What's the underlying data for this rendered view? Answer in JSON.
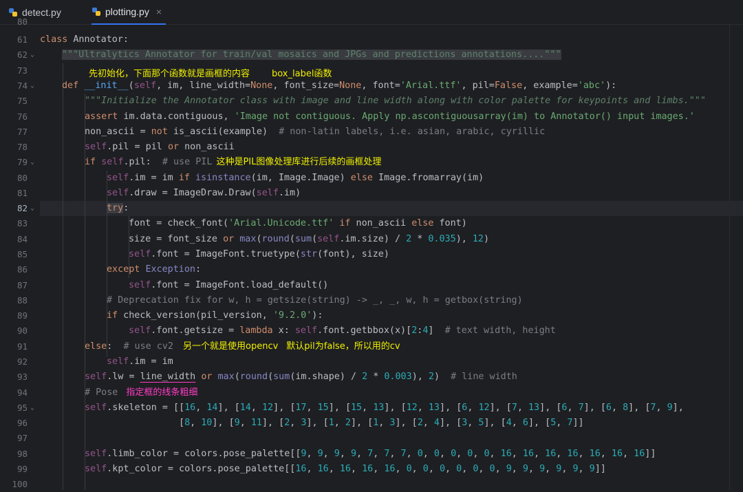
{
  "tabs": [
    {
      "label": "detect.py",
      "icon": "python-icon"
    },
    {
      "label": "plotting.py",
      "icon": "python-icon",
      "active": true
    }
  ],
  "close_glyph": "×",
  "line_numbers": [
    "80",
    "61",
    "62",
    "73",
    "74",
    "75",
    "76",
    "77",
    "78",
    "79",
    "80",
    "81",
    "82",
    "83",
    "84",
    "85",
    "86",
    "87",
    "88",
    "89",
    "90",
    "91",
    "92",
    "93",
    "94",
    "95",
    "96",
    "97",
    "98",
    "99",
    "100"
  ],
  "annotations": {
    "line73_a": "先初始化，下面那个函数就是画框的内容",
    "line73_b": "box_label函数",
    "line79": "这种是PIL图像处理库进行后续的画框处理",
    "line91_a": "另一个就是使用opencv",
    "line91_b": "默认pil为false，所以用的cv",
    "line94": "指定框的线条粗细"
  },
  "code": {
    "l61_kw": "class",
    "l61_name": " Annotator:",
    "l62_doc": "\"\"\"Ultralytics Annotator for train/val mosaics and JPGs and predictions annotations....\"\"\"",
    "l74_def": "def",
    "l74_fn": "__init__",
    "l74_a": "(",
    "l74_self": "self",
    "l74_b": ", im, line_width=",
    "l74_none1": "None",
    "l74_c": ", font_size=",
    "l74_none2": "None",
    "l74_d": ", font=",
    "l74_s1": "'Arial.ttf'",
    "l74_e": ", pil=",
    "l74_false": "False",
    "l74_f": ", example=",
    "l74_s2": "'abc'",
    "l74_g": "):",
    "l75_doc": "\"\"\"Initialize the Annotator class with image and line width along with color palette for keypoints and limbs.\"\"\"",
    "l76_kw": "assert",
    "l76_a": " im.data.contiguous, ",
    "l76_s": "'Image not contiguous. Apply np.ascontiguousarray(im) to Annotator() input images.'",
    "l77_a": "non_ascii = ",
    "l77_kw": "not",
    "l77_b": " is_ascii(example)  ",
    "l77_cm": "# non-latin labels, i.e. asian, arabic, cyrillic",
    "l78_self": "self",
    "l78_a": ".pil = pil ",
    "l78_kw": "or",
    "l78_b": " non_ascii",
    "l79_kw": "if",
    "l79_sp": " ",
    "l79_self": "self",
    "l79_a": ".pil:  ",
    "l79_cm": "# use PIL",
    "l80_self": "self",
    "l80_a": ".im = im ",
    "l80_kw": "if",
    "l80_sp": " ",
    "l80_bi": "isinstance",
    "l80_b": "(im, Image.Image) ",
    "l80_kw2": "else",
    "l80_c": " Image.fromarray(im)",
    "l81_self": "self",
    "l81_a": ".draw = ImageDraw.Draw(",
    "l81_self2": "self",
    "l81_b": ".im)",
    "l82_kw": "try",
    "l82_a": ":",
    "l83_a": "font = check_font(",
    "l83_s": "'Arial.Unicode.ttf'",
    "l83_sp": " ",
    "l83_kw": "if",
    "l83_b": " non_ascii ",
    "l83_kw2": "else",
    "l83_c": " font)",
    "l84_a": "size = font_size ",
    "l84_kw": "or",
    "l84_sp": " ",
    "l84_bi": "max",
    "l84_b": "(",
    "l84_bi2": "round",
    "l84_c": "(",
    "l84_bi3": "sum",
    "l84_d": "(",
    "l84_self": "self",
    "l84_e": ".im.size) / ",
    "l84_n1": "2",
    "l84_f": " * ",
    "l84_n2": "0.035",
    "l84_g": "), ",
    "l84_n3": "12",
    "l84_h": ")",
    "l85_self": "self",
    "l85_a": ".font = ImageFont.truetype(",
    "l85_bi": "str",
    "l85_b": "(font), size)",
    "l86_kw": "except",
    "l86_sp": " ",
    "l86_ex": "Exception",
    "l86_a": ":",
    "l87_self": "self",
    "l87_a": ".font = ImageFont.load_default()",
    "l88_cm": "# Deprecation fix for w, h = getsize(string) -> _, _, w, h = getbox(string)",
    "l89_kw": "if",
    "l89_a": " check_version(pil_version, ",
    "l89_s": "'9.2.0'",
    "l89_b": "):",
    "l90_self": "self",
    "l90_a": ".font.getsize = ",
    "l90_kw": "lambda",
    "l90_b": " x: ",
    "l90_self2": "self",
    "l90_c": ".font.getbbox(x)[",
    "l90_n1": "2",
    "l90_d": ":",
    "l90_n2": "4",
    "l90_e": "]  ",
    "l90_cm": "# text width, height",
    "l91_kw": "else",
    "l91_a": ":  ",
    "l91_cm": "# use cv2",
    "l92_self": "self",
    "l92_a": ".im = im",
    "l93_self": "self",
    "l93_a": ".lw = ",
    "l93_u": "line_width",
    "l93_sp": " ",
    "l93_kw": "or",
    "l93_sp2": " ",
    "l93_bi": "max",
    "l93_b": "(",
    "l93_bi2": "round",
    "l93_c": "(",
    "l93_bi3": "sum",
    "l93_d": "(im.shape) / ",
    "l93_n1": "2",
    "l93_e": " * ",
    "l93_n2": "0.003",
    "l93_f": "), ",
    "l93_n3": "2",
    "l93_g": ")  ",
    "l93_cm": "# line width",
    "l94_cm": "# Pose",
    "l95_self": "self",
    "l95_a": ".skeleton = [",
    "l98_self": "self",
    "l98_a": ".limb_color = colors.pose_palette[[",
    "l99_self": "self",
    "l99_a": ".kpt_color = colors.pose_palette[["
  },
  "skeleton_row1": [
    [
      16,
      14
    ],
    [
      14,
      12
    ],
    [
      17,
      15
    ],
    [
      15,
      13
    ],
    [
      12,
      13
    ],
    [
      6,
      12
    ],
    [
      7,
      13
    ],
    [
      6,
      7
    ],
    [
      6,
      8
    ],
    [
      7,
      9
    ]
  ],
  "skeleton_row2": [
    [
      8,
      10
    ],
    [
      9,
      11
    ],
    [
      2,
      3
    ],
    [
      1,
      2
    ],
    [
      1,
      3
    ],
    [
      2,
      4
    ],
    [
      3,
      5
    ],
    [
      4,
      6
    ],
    [
      5,
      7
    ]
  ],
  "limb_color": [
    9,
    9,
    9,
    9,
    7,
    7,
    7,
    0,
    0,
    0,
    0,
    0,
    16,
    16,
    16,
    16,
    16,
    16,
    16
  ],
  "kpt_color": [
    16,
    16,
    16,
    16,
    16,
    0,
    0,
    0,
    0,
    0,
    0,
    9,
    9,
    9,
    9,
    9,
    9
  ],
  "colors": {
    "background": "#1e1f22",
    "keyword": "#cf8e6d",
    "string": "#6aab73",
    "number": "#2aacb8",
    "comment": "#7a7e85",
    "self": "#94558d",
    "annotation": "#f0f000",
    "annotation_pink": "#ff3cc8"
  }
}
